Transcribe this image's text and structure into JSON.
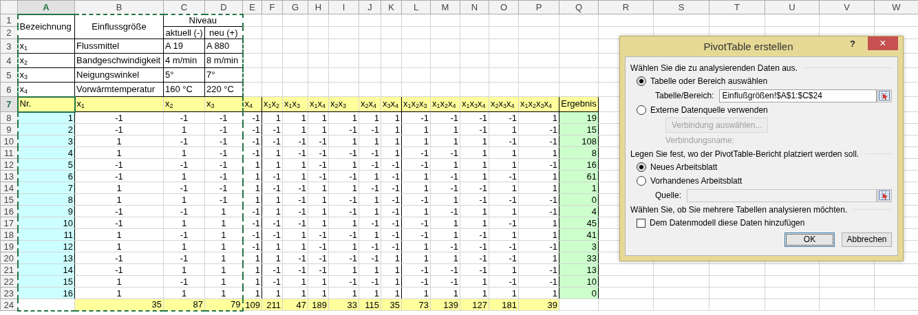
{
  "sheet": {
    "columns": [
      {
        "label": "A",
        "selected": true
      },
      {
        "label": "B",
        "selected": false
      },
      {
        "label": "C",
        "selected": false
      },
      {
        "label": "D",
        "selected": false
      },
      {
        "label": "E",
        "selected": false
      },
      {
        "label": "F",
        "selected": false
      },
      {
        "label": "G",
        "selected": false
      },
      {
        "label": "H",
        "selected": false
      },
      {
        "label": "I",
        "selected": false
      },
      {
        "label": "J",
        "selected": false
      },
      {
        "label": "K",
        "selected": false
      },
      {
        "label": "L",
        "selected": false
      },
      {
        "label": "M",
        "selected": false
      },
      {
        "label": "N",
        "selected": false
      },
      {
        "label": "O",
        "selected": false
      },
      {
        "label": "P",
        "selected": false
      },
      {
        "label": "Q",
        "selected": false
      },
      {
        "label": "R",
        "selected": false
      },
      {
        "label": "S",
        "selected": false
      },
      {
        "label": "T",
        "selected": false
      },
      {
        "label": "U",
        "selected": false
      },
      {
        "label": "V",
        "selected": false
      },
      {
        "label": "W",
        "selected": false
      }
    ],
    "rows": [
      {
        "label": "1",
        "kind": "title",
        "selected": false,
        "cells": [
          {
            "text": "Bezeichnung",
            "rowspan": 2
          },
          {
            "text": "Einflussgröße",
            "rowspan": 2
          },
          {
            "text": "Niveau",
            "colspan": 2
          }
        ]
      },
      {
        "label": "2",
        "kind": "title",
        "selected": false,
        "cells": [
          "aktuell (-)",
          "neu (+)"
        ]
      },
      {
        "label": "3",
        "kind": "info",
        "selected": false,
        "cells": [
          "x$_{1}$",
          "Flussmittel",
          "A 19",
          "A 880"
        ]
      },
      {
        "label": "4",
        "kind": "info",
        "selected": false,
        "cells": [
          "x$_{2}$",
          "Bandgeschwindigkeit",
          "4 m/min",
          "8 m/min"
        ]
      },
      {
        "label": "5",
        "kind": "info",
        "selected": false,
        "cells": [
          "x$_{3}$",
          "Neigungswinkel",
          "5°",
          "7°"
        ]
      },
      {
        "label": "6",
        "kind": "info",
        "selected": false,
        "cells": [
          "x$_{4}$",
          "Vorwärmtemperatur",
          "160 °C",
          "220 °C"
        ]
      },
      {
        "label": "7",
        "kind": "header",
        "selected": true,
        "cells": [
          "Nr.",
          "x$_{1}$",
          "x$_{2}$",
          "x$_{3}$",
          "x$_{4}$",
          "x$_{1}$x$_{2}$",
          "x$_{1}$x$_{3}$",
          "x$_{1}$x$_{4}$",
          "x$_{2}$x$_{3}$",
          "x$_{2}$x$_{4}$",
          "x$_{3}$x$_{4}$",
          "x$_{1}$x$_{2}$x$_{3}$",
          "x$_{1}$x$_{2}$x$_{4}$",
          "x$_{1}$x$_{3}$x$_{4}$",
          "x$_{2}$x$_{3}$x$_{4}$",
          "x$_{1}$x$_{2}$x$_{3}$x$_{4}$",
          "Ergebnis"
        ]
      },
      {
        "label": "8",
        "kind": "run",
        "selected": false,
        "cells": [
          "1",
          "-1",
          "-1",
          "-1",
          "-1",
          "1",
          "1",
          "1",
          "1",
          "1",
          "1",
          "-1",
          "-1",
          "-1",
          "-1",
          "1",
          "19"
        ]
      },
      {
        "label": "9",
        "kind": "run",
        "selected": false,
        "cells": [
          "2",
          "-1",
          "1",
          "-1",
          "-1",
          "-1",
          "1",
          "1",
          "-1",
          "-1",
          "1",
          "1",
          "1",
          "-1",
          "1",
          "-1",
          "15"
        ]
      },
      {
        "label": "10",
        "kind": "run",
        "selected": false,
        "cells": [
          "3",
          "1",
          "-1",
          "-1",
          "-1",
          "-1",
          "-1",
          "-1",
          "1",
          "1",
          "1",
          "1",
          "1",
          "1",
          "-1",
          "-1",
          "108"
        ]
      },
      {
        "label": "11",
        "kind": "run",
        "selected": false,
        "cells": [
          "4",
          "1",
          "1",
          "-1",
          "-1",
          "1",
          "-1",
          "-1",
          "-1",
          "-1",
          "1",
          "-1",
          "-1",
          "1",
          "1",
          "1",
          "8"
        ]
      },
      {
        "label": "12",
        "kind": "run",
        "selected": false,
        "cells": [
          "5",
          "-1",
          "-1",
          "-1",
          "1",
          "1",
          "1",
          "-1",
          "1",
          "-1",
          "-1",
          "-1",
          "1",
          "1",
          "1",
          "-1",
          "16"
        ]
      },
      {
        "label": "13",
        "kind": "run",
        "selected": false,
        "cells": [
          "6",
          "-1",
          "1",
          "-1",
          "1",
          "-1",
          "1",
          "-1",
          "-1",
          "1",
          "-1",
          "1",
          "-1",
          "1",
          "-1",
          "1",
          "61"
        ]
      },
      {
        "label": "14",
        "kind": "run",
        "selected": false,
        "cells": [
          "7",
          "1",
          "-1",
          "-1",
          "1",
          "-1",
          "-1",
          "1",
          "1",
          "-1",
          "-1",
          "1",
          "-1",
          "-1",
          "1",
          "1",
          "1"
        ]
      },
      {
        "label": "15",
        "kind": "run",
        "selected": false,
        "cells": [
          "8",
          "1",
          "1",
          "-1",
          "1",
          "1",
          "-1",
          "1",
          "-1",
          "1",
          "-1",
          "-1",
          "1",
          "-1",
          "-1",
          "-1",
          "0"
        ]
      },
      {
        "label": "16",
        "kind": "run",
        "selected": false,
        "cells": [
          "9",
          "-1",
          "-1",
          "1",
          "-1",
          "1",
          "-1",
          "1",
          "-1",
          "1",
          "-1",
          "1",
          "-1",
          "1",
          "1",
          "-1",
          "4"
        ]
      },
      {
        "label": "17",
        "kind": "run",
        "selected": false,
        "cells": [
          "10",
          "-1",
          "1",
          "1",
          "-1",
          "-1",
          "-1",
          "1",
          "1",
          "-1",
          "-1",
          "-1",
          "1",
          "1",
          "-1",
          "1",
          "45"
        ]
      },
      {
        "label": "18",
        "kind": "run",
        "selected": false,
        "cells": [
          "11",
          "1",
          "-1",
          "1",
          "-1",
          "-1",
          "1",
          "-1",
          "-1",
          "1",
          "-1",
          "-1",
          "1",
          "-1",
          "1",
          "1",
          "41"
        ]
      },
      {
        "label": "19",
        "kind": "run",
        "selected": false,
        "cells": [
          "12",
          "1",
          "1",
          "1",
          "-1",
          "1",
          "1",
          "-1",
          "1",
          "-1",
          "-1",
          "1",
          "-1",
          "-1",
          "-1",
          "-1",
          "3"
        ]
      },
      {
        "label": "20",
        "kind": "run",
        "selected": false,
        "cells": [
          "13",
          "-1",
          "-1",
          "1",
          "1",
          "1",
          "-1",
          "-1",
          "-1",
          "-1",
          "1",
          "1",
          "1",
          "-1",
          "-1",
          "1",
          "33"
        ]
      },
      {
        "label": "21",
        "kind": "run",
        "selected": false,
        "cells": [
          "14",
          "-1",
          "1",
          "1",
          "1",
          "-1",
          "-1",
          "-1",
          "1",
          "1",
          "1",
          "-1",
          "-1",
          "-1",
          "1",
          "-1",
          "13"
        ]
      },
      {
        "label": "22",
        "kind": "run",
        "selected": false,
        "cells": [
          "15",
          "1",
          "-1",
          "1",
          "1",
          "-1",
          "1",
          "1",
          "-1",
          "-1",
          "1",
          "-1",
          "-1",
          "1",
          "-1",
          "-1",
          "10"
        ]
      },
      {
        "label": "23",
        "kind": "run",
        "selected": false,
        "cells": [
          "16",
          "1",
          "1",
          "1",
          "1",
          "1",
          "1",
          "1",
          "1",
          "1",
          "1",
          "1",
          "1",
          "1",
          "1",
          "1",
          "0"
        ]
      },
      {
        "label": "24",
        "kind": "sum",
        "selected": false,
        "cells": [
          null,
          "35",
          "87",
          "79",
          "109",
          "211",
          "47",
          "189",
          "33",
          "115",
          "35",
          "73",
          "139",
          "127",
          "181",
          "39"
        ]
      }
    ]
  },
  "dialog": {
    "title": "PivotTable erstellen",
    "help": "?",
    "close": "×",
    "sections": [
      {
        "heading": "Wählen Sie die zu analysierenden Daten aus.",
        "items": [
          {
            "kind": "radio",
            "label": "Tabelle oder Bereich auswählen",
            "selected": true
          },
          {
            "kind": "field",
            "label": "Tabelle/Bereich:",
            "value": "Einflußgrößen!$A$1:$C$24",
            "disabled": false
          },
          {
            "kind": "radio",
            "label": "Externe Datenquelle verwenden",
            "selected": false
          },
          {
            "kind": "button",
            "label": "Verbindung auswählen...",
            "disabled": true
          },
          {
            "kind": "caption",
            "text": "Verbindungsname:",
            "disabled": true
          }
        ]
      },
      {
        "heading": "Legen Sie fest, wo der PivotTable-Bericht platziert werden soll.",
        "items": [
          {
            "kind": "radio",
            "label": "Neues Arbeitsblatt",
            "selected": true
          },
          {
            "kind": "radio",
            "label": "Vorhandenes Arbeitsblatt",
            "selected": false
          },
          {
            "kind": "field",
            "label": "Quelle:",
            "disabled": true
          }
        ]
      },
      {
        "heading": "Wählen Sie, ob Sie mehrere Tabellen analysieren möchten.",
        "items": [
          {
            "kind": "checkbox",
            "label": "Dem Datenmodell diese Daten hinzufügen",
            "checked": false
          }
        ]
      }
    ],
    "buttons": [
      {
        "label": "OK",
        "default": true
      },
      {
        "label": "Abbrechen",
        "default": false
      }
    ]
  }
}
